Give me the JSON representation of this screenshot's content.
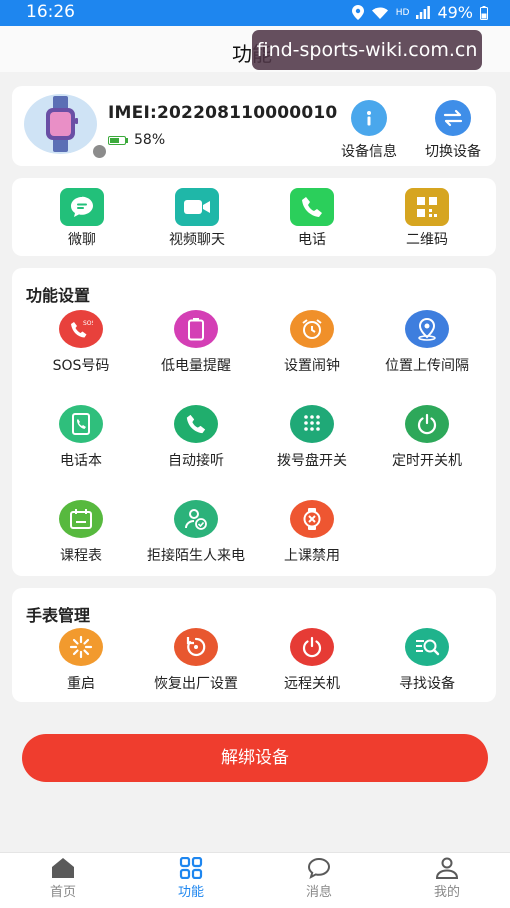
{
  "status_bar": {
    "time": "16:26",
    "hd": "HD",
    "battery": "49%"
  },
  "header": {
    "title": "功能"
  },
  "watermark": "find-sports-wiki.com.cn",
  "device": {
    "imei": "IMEI:202208110000010",
    "battery_percent": "58%",
    "battery_level": 0.58,
    "actions": [
      {
        "label": "设备信息",
        "icon": "info-icon",
        "color": "#4aa7ec"
      },
      {
        "label": "切换设备",
        "icon": "switch-icon",
        "color": "#3f8ee8"
      }
    ]
  },
  "quick_actions": [
    {
      "label": "微聊",
      "icon": "chat-bubble-icon",
      "color": "#22c07a"
    },
    {
      "label": "视频聊天",
      "icon": "video-camera-icon",
      "color": "#1fb7a8"
    },
    {
      "label": "电话",
      "icon": "phone-icon",
      "color": "#2bcf5b"
    },
    {
      "label": "二维码",
      "icon": "qr-code-icon",
      "color": "#d6a520"
    }
  ],
  "settings": {
    "title": "功能设置",
    "items": [
      {
        "label": "SOS号码",
        "icon": "sos-phone-icon",
        "color": "#e8413c"
      },
      {
        "label": "低电量提醒",
        "icon": "low-battery-icon",
        "color": "#d43fb5"
      },
      {
        "label": "设置闹钟",
        "icon": "alarm-clock-icon",
        "color": "#f0902a"
      },
      {
        "label": "位置上传间隔",
        "icon": "location-icon",
        "color": "#3e7ede"
      },
      {
        "label": "电话本",
        "icon": "phonebook-icon",
        "color": "#2fbf7c"
      },
      {
        "label": "自动接听",
        "icon": "auto-answer-icon",
        "color": "#20ae6d"
      },
      {
        "label": "拨号盘开关",
        "icon": "dialpad-icon",
        "color": "#1fa977"
      },
      {
        "label": "定时开关机",
        "icon": "power-timer-icon",
        "color": "#2da85a"
      },
      {
        "label": "课程表",
        "icon": "schedule-icon",
        "color": "#57b93e"
      },
      {
        "label": "拒接陌生人来电",
        "icon": "reject-stranger-icon",
        "color": "#2bb27a"
      },
      {
        "label": "上课禁用",
        "icon": "class-disable-icon",
        "color": "#ee5631"
      }
    ]
  },
  "manage": {
    "title": "手表管理",
    "items": [
      {
        "label": "重启",
        "icon": "restart-icon",
        "color": "#f29a2e"
      },
      {
        "label": "恢复出厂设置",
        "icon": "factory-reset-icon",
        "color": "#e8572f"
      },
      {
        "label": "远程关机",
        "icon": "power-off-icon",
        "color": "#e63b35"
      },
      {
        "label": "寻找设备",
        "icon": "find-device-icon",
        "color": "#1fb38c"
      }
    ]
  },
  "unbind_button": "解绑设备",
  "tabs": [
    {
      "label": "首页",
      "icon": "home-icon",
      "active": false
    },
    {
      "label": "功能",
      "icon": "grid-icon",
      "active": true
    },
    {
      "label": "消息",
      "icon": "message-icon",
      "active": false
    },
    {
      "label": "我的",
      "icon": "profile-icon",
      "active": false
    }
  ],
  "colors": {
    "accent": "#1e86ef",
    "danger": "#ef3d2e"
  }
}
